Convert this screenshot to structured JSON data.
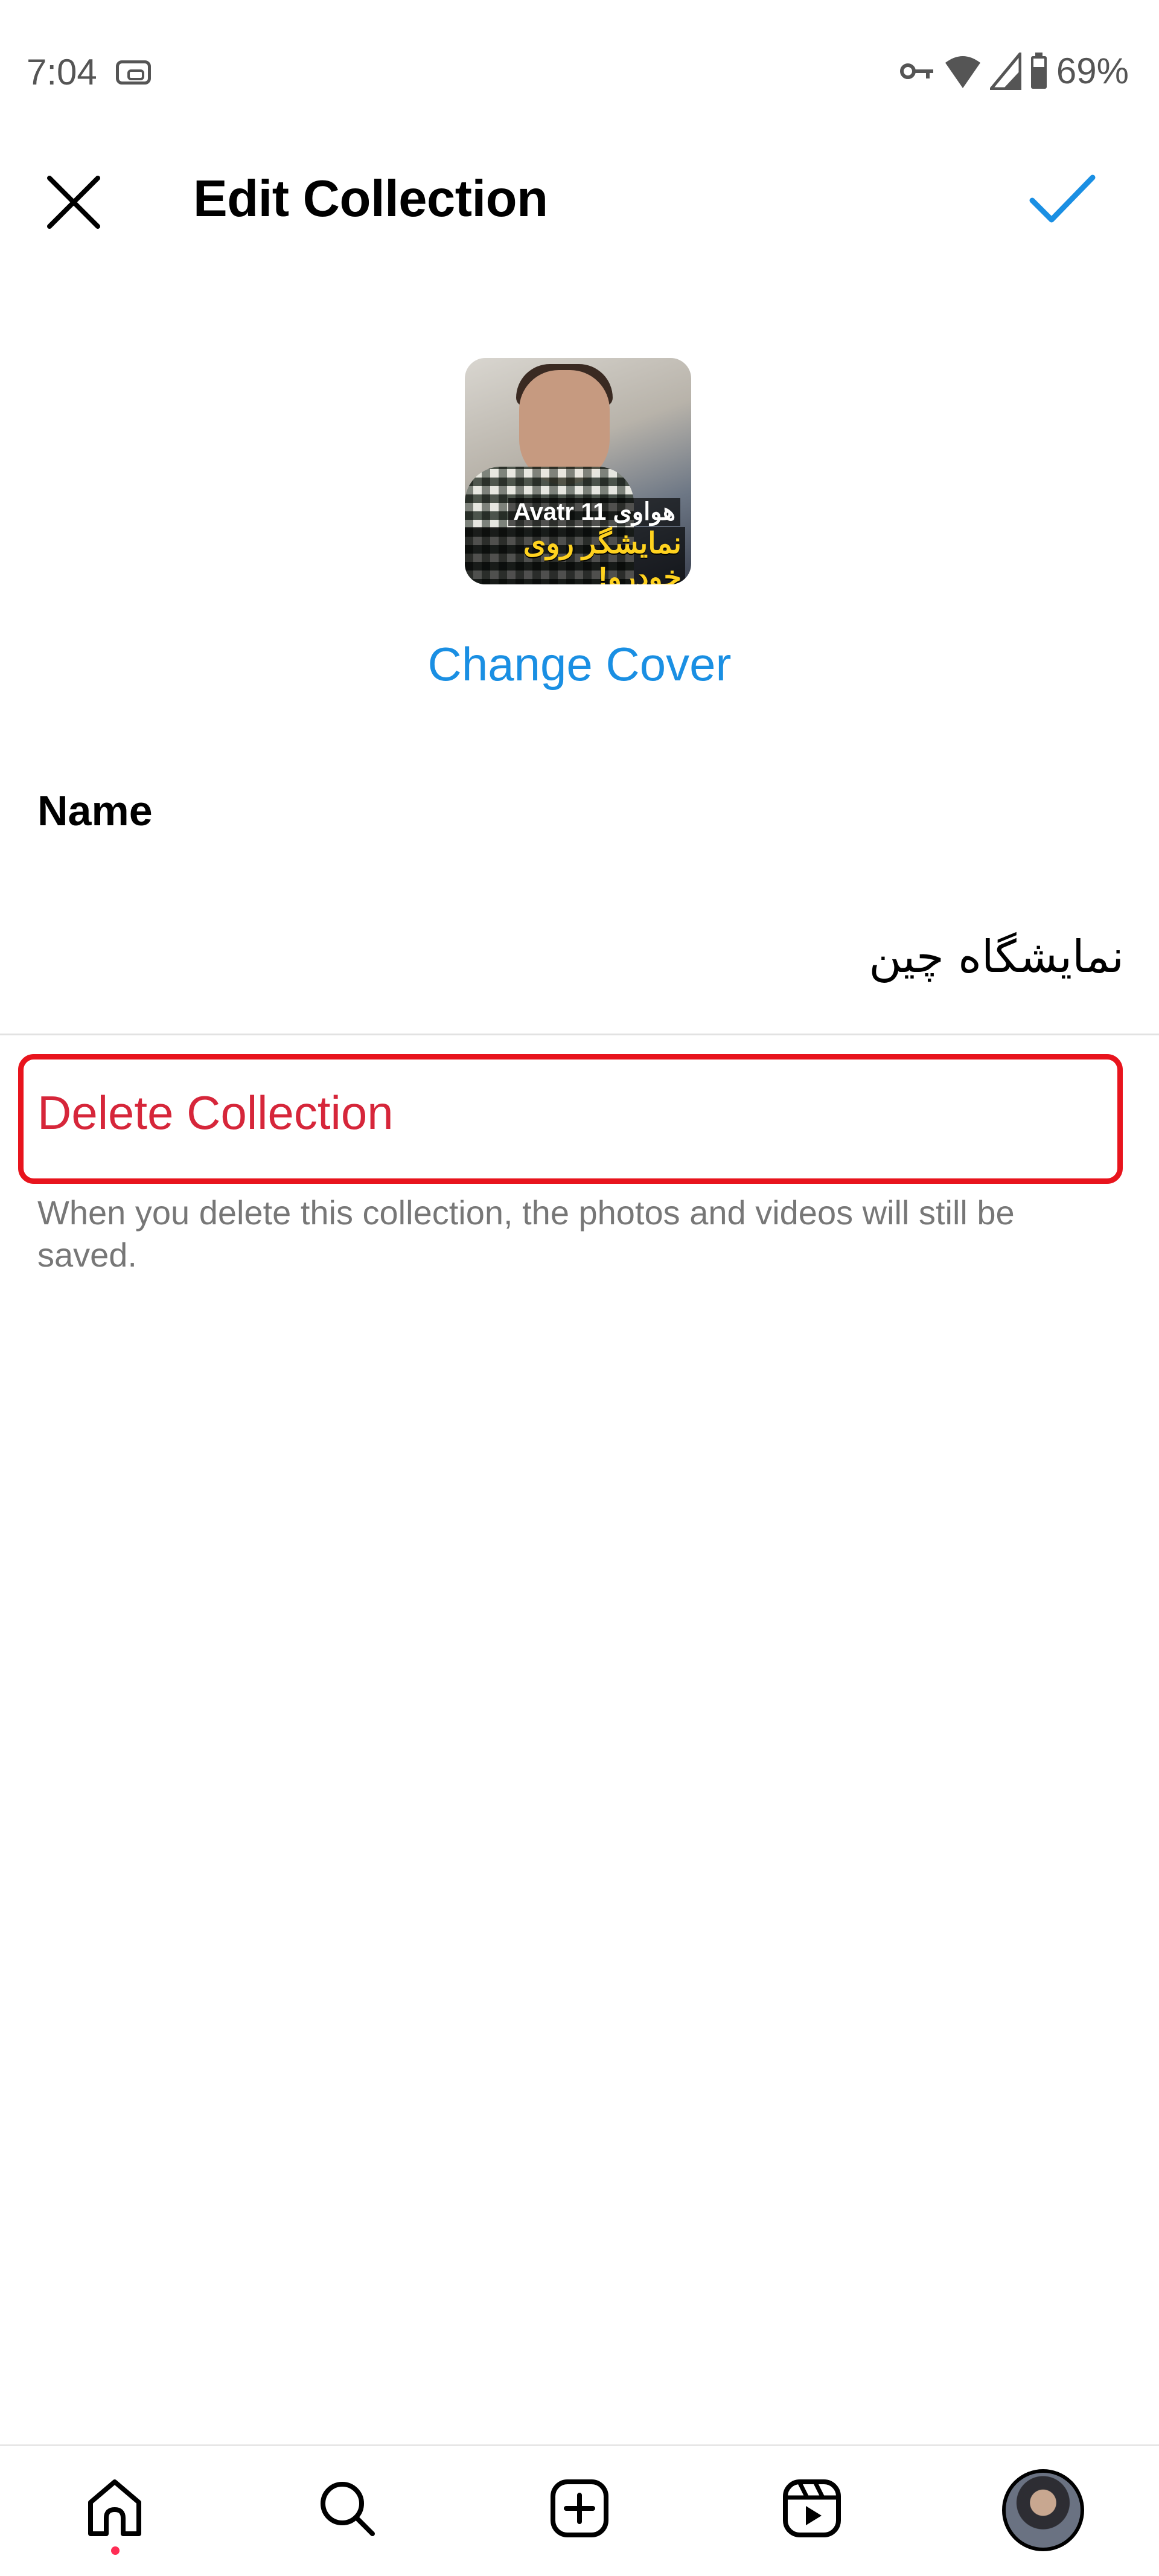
{
  "status_bar": {
    "time": "7:04",
    "battery_percent": "69%",
    "icons": [
      "cast-icon",
      "vpn-key-icon",
      "wifi-icon",
      "signal-icon",
      "battery-icon"
    ]
  },
  "header": {
    "title": "Edit Collection",
    "close_icon": "close-icon",
    "confirm_icon": "check-icon",
    "accent_color": "#1a8fe3"
  },
  "cover": {
    "caption_line1": "هواوی Avatr 11",
    "caption_line2": "نمایشگر روی خودرو!",
    "change_cover_label": "Change Cover"
  },
  "name_field": {
    "label": "Name",
    "value": "نمایشگاه چین"
  },
  "delete": {
    "label": "Delete Collection",
    "help_text": "When you delete this collection, the photos and videos will still be saved.",
    "color": "#d6263a",
    "highlight_color": "#e8141d"
  },
  "bottom_nav": {
    "items": [
      {
        "name": "home",
        "icon": "home-icon",
        "has_notification_dot": true
      },
      {
        "name": "search",
        "icon": "search-icon"
      },
      {
        "name": "create",
        "icon": "plus-square-icon"
      },
      {
        "name": "reels",
        "icon": "reels-icon"
      },
      {
        "name": "profile",
        "icon": "avatar"
      }
    ]
  }
}
